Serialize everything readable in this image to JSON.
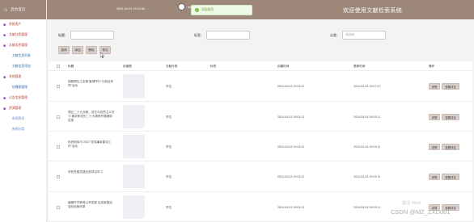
{
  "sidebar": {
    "logo": "后台首页",
    "items": [
      {
        "type": "group",
        "label": "系统用户"
      },
      {
        "type": "group",
        "label": "文献分类管理"
      },
      {
        "type": "group",
        "label": "文献信息管理"
      },
      {
        "type": "item",
        "label": "文献信息列表"
      },
      {
        "type": "item",
        "label": "文献信息添加"
      },
      {
        "type": "group",
        "label": "系统管理"
      },
      {
        "type": "item",
        "label": "轮播图管理"
      },
      {
        "type": "group",
        "label": "公告信息管理"
      },
      {
        "type": "group",
        "label": "资源管理"
      },
      {
        "type": "item",
        "label": "新闻资讯"
      },
      {
        "type": "item",
        "label": "新闻分类"
      }
    ]
  },
  "header": {
    "time": "2024-04-03 19:15:38",
    "username": "adi",
    "title": "欢迎使用文献检索系统"
  },
  "toast": {
    "message": "添加成功"
  },
  "filters": {
    "title_label": "标题:",
    "tag_label": "标签:",
    "category_label": "分类:",
    "category_placeholder": "请选择"
  },
  "toolbar": {
    "search": "查询",
    "add": "添加",
    "delete": "删除",
    "export": "导出"
  },
  "table": {
    "headers": [
      "标题",
      "封面图",
      "文献分类",
      "标签",
      "创建时间",
      "更新时间",
      "操作"
    ],
    "rows": [
      {
        "title": "团委理论之友第 备课举行“与新结伴同”活动",
        "category": "学位",
        "created": "2024-04-03 19:03:11",
        "updated": "2024-04-03 19:07:57"
      },
      {
        "title": "理论二十大对第，党在马克思主义学习 要求和党的二十大精神专题辅导讲座",
        "category": "学位",
        "created": "2024-04-03 19:03:11",
        "updated": "2024-04-03 19:03:11"
      },
      {
        "title": "传统电商与“2022”党风廉政建设工作”活动",
        "category": "学位",
        "created": "2024-04-03 19:03:11",
        "updated": "2024-04-03 19:03:11"
      },
      {
        "title": "学校党建党建优秀项目学习",
        "category": "学位",
        "created": "2024-04-03 19:03:11",
        "updated": "2024-04-03 19:03:11"
      },
      {
        "title": "编辑开学教育以来党委 后成家建设强化经营改革",
        "category": "学位",
        "created": "2024-04-03 19:03:11",
        "updated": "2024-04-03 19:03:11"
      }
    ],
    "action_detail": "详情",
    "action_view": "查看评论"
  },
  "overlay": {
    "activate": "激活 Wind",
    "csdn": "CSDN @MZ_ZXD001"
  },
  "colors": {
    "brand": "#9c8779",
    "toast_bg": "#eef8e6",
    "toast_text": "#5b9b3a"
  }
}
